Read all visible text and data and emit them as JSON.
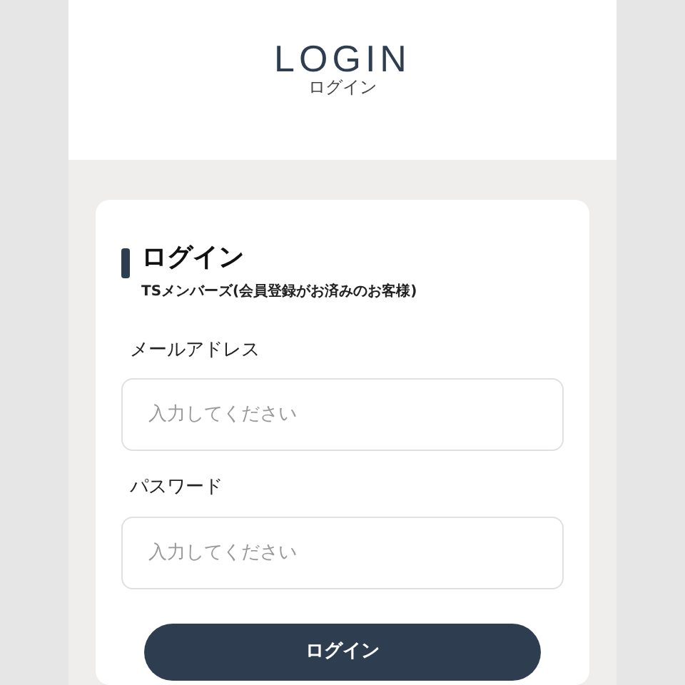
{
  "header": {
    "title": "LOGIN",
    "subtitle": "ログイン"
  },
  "form": {
    "heading": "ログイン",
    "description": "TSメンバーズ(会員登録がお済みのお客様)",
    "fields": [
      {
        "label": "メールアドレス",
        "placeholder": "入力してください"
      },
      {
        "label": "パスワード",
        "placeholder": "入力してください"
      }
    ],
    "submit": "ログイン"
  }
}
